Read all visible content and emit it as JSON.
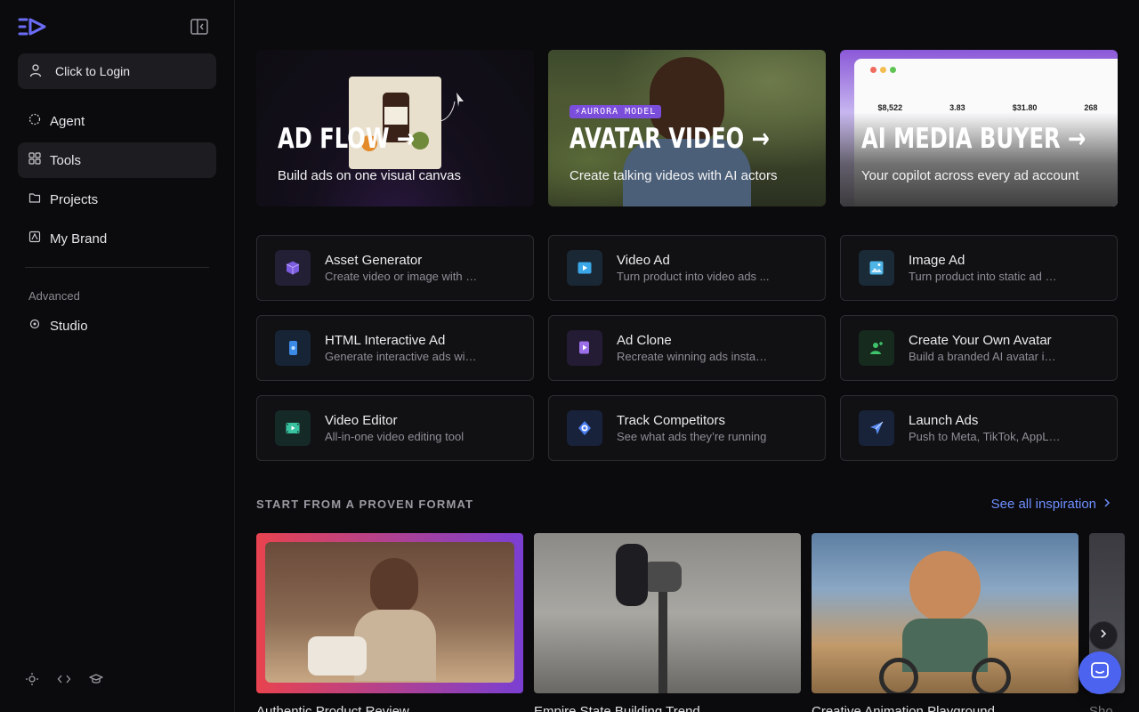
{
  "sidebar": {
    "login_label": "Click to Login",
    "nav": [
      {
        "label": "Agent",
        "icon": "agent-icon"
      },
      {
        "label": "Tools",
        "icon": "grid-icon",
        "active": true
      },
      {
        "label": "Projects",
        "icon": "folder-icon"
      },
      {
        "label": "My Brand",
        "icon": "brand-icon"
      }
    ],
    "advanced_title": "Advanced",
    "advanced": [
      {
        "label": "Studio",
        "icon": "studio-icon"
      }
    ]
  },
  "heroes": [
    {
      "title": "AD FLOW →",
      "subtitle": "Build ads on one visual canvas"
    },
    {
      "badge": "⚡AURORA MODEL",
      "title": "AVATAR VIDEO →",
      "subtitle": "Create talking videos with AI actors"
    },
    {
      "title": "AI MEDIA BUYER →",
      "subtitle": "Your copilot across every ad account"
    }
  ],
  "tools": [
    {
      "name": "Asset Generator",
      "desc": "Create video or image with a...",
      "icon": "cube-icon",
      "color": "#7c5ce0"
    },
    {
      "name": "Video Ad",
      "desc": "Turn product into video ads ...",
      "icon": "play-icon",
      "color": "#3aa7e8"
    },
    {
      "name": "Image Ad",
      "desc": "Turn product into static ad cr...",
      "icon": "image-icon",
      "color": "#4fb4e8"
    },
    {
      "name": "HTML Interactive Ad",
      "desc": "Generate interactive ads with...",
      "icon": "phone-icon",
      "color": "#3b8ae6"
    },
    {
      "name": "Ad Clone",
      "desc": "Recreate winning ads instant...",
      "icon": "clone-icon",
      "color": "#9a6ee8"
    },
    {
      "name": "Create Your Own Avatar",
      "desc": "Build a branded AI avatar in s...",
      "icon": "avatar-add-icon",
      "color": "#3ec26a"
    },
    {
      "name": "Video Editor",
      "desc": "All-in-one video editing tool",
      "icon": "film-icon",
      "color": "#38c2a0"
    },
    {
      "name": "Track Competitors",
      "desc": "See what ads they’re running",
      "icon": "target-icon",
      "color": "#4a7ef0"
    },
    {
      "name": "Launch Ads",
      "desc": "Push to Meta, TikTok, AppLov...",
      "icon": "send-icon",
      "color": "#5a8cf2"
    }
  ],
  "formats": {
    "title": "START FROM A PROVEN FORMAT",
    "see_all": "See all inspiration",
    "cards": [
      {
        "label": "Authentic Product Review"
      },
      {
        "label": "Empire State Building Trend"
      },
      {
        "label": "Creative Animation Playground"
      },
      {
        "label": "Sho"
      }
    ]
  },
  "hero_preview": {
    "metrics": [
      "$8,522",
      "3.83",
      "$31.80",
      "268"
    ]
  }
}
